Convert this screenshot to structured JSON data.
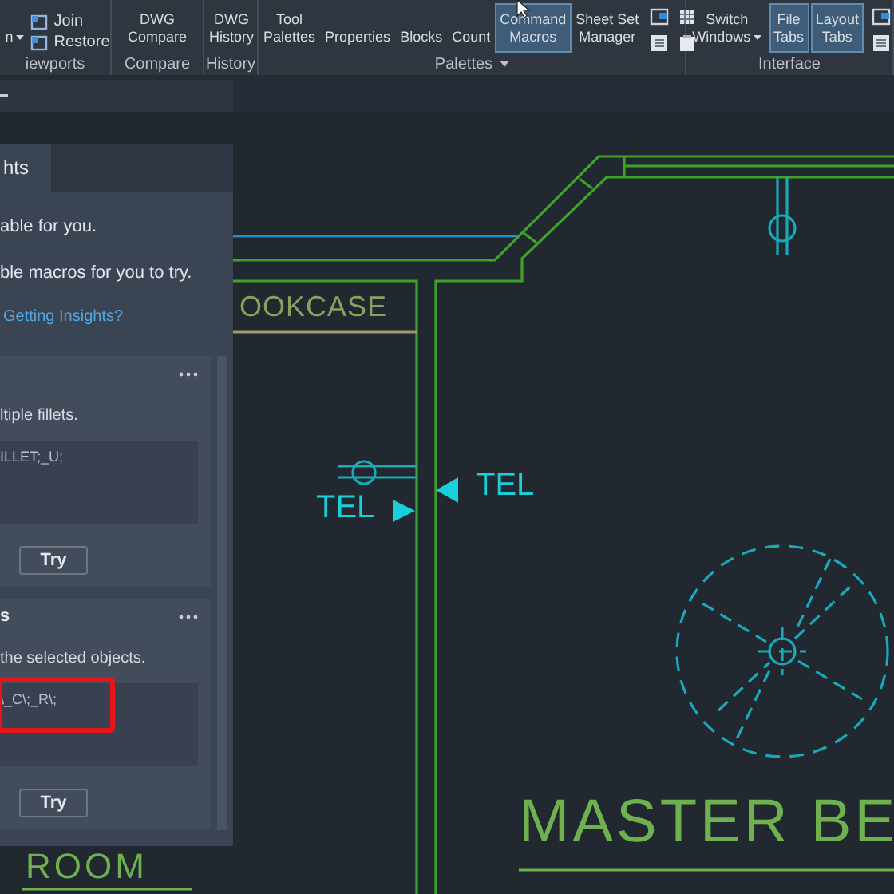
{
  "ribbon": {
    "groups": [
      {
        "label": "iewports",
        "items": [
          {
            "kind": "dropdown",
            "lines": [
              "n"
            ],
            "selected": false
          },
          {
            "kind": "stack",
            "lines": [
              "Join",
              "Restore"
            ]
          }
        ]
      },
      {
        "label": "Compare",
        "items": [
          {
            "kind": "large",
            "lines": [
              "DWG",
              "Compare"
            ],
            "selected": false
          }
        ]
      },
      {
        "label": "History",
        "items": [
          {
            "kind": "large",
            "lines": [
              "DWG",
              "History"
            ],
            "selected": false
          }
        ]
      },
      {
        "label": "Palettes",
        "dropdown": true,
        "items": [
          {
            "kind": "large",
            "lines": [
              "Tool",
              "Palettes"
            ],
            "selected": false
          },
          {
            "kind": "large",
            "lines": [
              "Properties"
            ],
            "selected": false
          },
          {
            "kind": "large",
            "lines": [
              "Blocks"
            ],
            "selected": false
          },
          {
            "kind": "large",
            "lines": [
              "Count"
            ],
            "selected": false
          },
          {
            "kind": "large",
            "lines": [
              "Command",
              "Macros"
            ],
            "selected": true
          },
          {
            "kind": "large",
            "lines": [
              "Sheet Set",
              "Manager"
            ],
            "selected": false
          },
          {
            "kind": "icon-grid"
          }
        ]
      },
      {
        "label": "Interface",
        "items": [
          {
            "kind": "dropdown",
            "lines": [
              "Switch",
              "Windows"
            ],
            "selected": false
          },
          {
            "kind": "large",
            "lines": [
              "File",
              "Tabs"
            ],
            "selected": true
          },
          {
            "kind": "large",
            "lines": [
              "Layout",
              "Tabs"
            ],
            "selected": true
          },
          {
            "kind": "icon-column"
          }
        ]
      }
    ]
  },
  "panel": {
    "tab": "hts",
    "lines": [
      "able for you.",
      "ble macros for you to try."
    ],
    "link": "Getting Insights?",
    "cards": [
      {
        "description": "ltiple fillets.",
        "code": "ILLET;_U;",
        "button": "Try",
        "highlighted": false
      },
      {
        "title": "s",
        "description": "the selected objects.",
        "code": "\\_C\\;_R\\;",
        "button": "Try",
        "highlighted": true
      }
    ]
  },
  "canvas": {
    "labels": [
      {
        "kind": "tag",
        "text": "OOKCASE"
      },
      {
        "kind": "tel",
        "text": "TEL"
      },
      {
        "kind": "tel",
        "text": "TEL"
      },
      {
        "kind": "room",
        "text": "MASTER BE"
      },
      {
        "kind": "room",
        "text": "ROOM"
      }
    ]
  }
}
